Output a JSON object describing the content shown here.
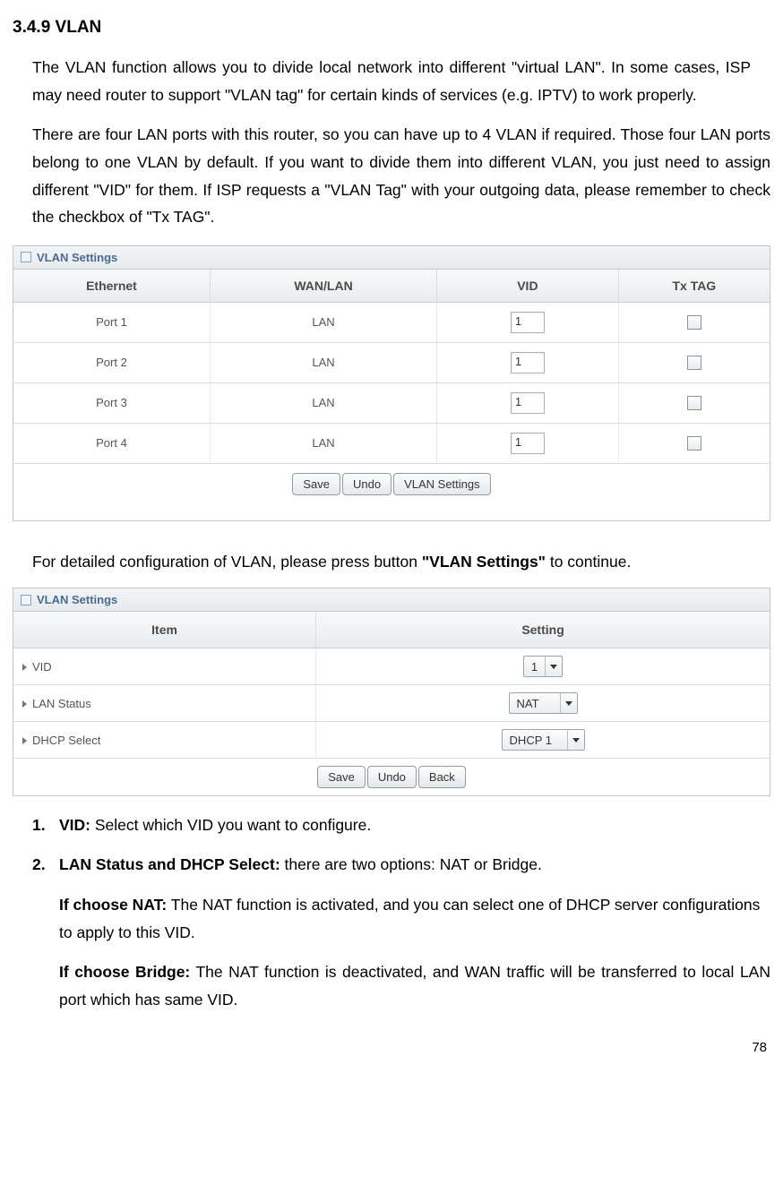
{
  "heading": "3.4.9 VLAN",
  "intro_p1": "The VLAN function allows you to divide local network into different \"virtual LAN\". In some cases, ISP may need router to support \"VLAN tag\" for certain kinds of services (e.g. IPTV) to work properly.",
  "intro_p2": "There are four LAN ports with this router, so you can have up to 4 VLAN if required. Those four LAN ports belong to one VLAN by default. If you want to divide them into different VLAN, you just need to assign different \"VID\" for them. If ISP requests a \"VLAN Tag\" with your outgoing data, please remember to check the checkbox of \"Tx TAG\".",
  "panel1": {
    "title": "VLAN Settings",
    "headers": [
      "Ethernet",
      "WAN/LAN",
      "VID",
      "Tx TAG"
    ],
    "rows": [
      {
        "eth": "Port 1",
        "wl": "LAN",
        "vid": "1"
      },
      {
        "eth": "Port 2",
        "wl": "LAN",
        "vid": "1"
      },
      {
        "eth": "Port 3",
        "wl": "LAN",
        "vid": "1"
      },
      {
        "eth": "Port 4",
        "wl": "LAN",
        "vid": "1"
      }
    ],
    "buttons": {
      "save": "Save",
      "undo": "Undo",
      "vsettings": "VLAN Settings"
    }
  },
  "mid_text_pre": "For detailed configuration of VLAN, please press button ",
  "mid_text_bold": "\"VLAN Settings\"",
  "mid_text_post": " to continue.",
  "panel2": {
    "title": "VLAN Settings",
    "headers": {
      "item": "Item",
      "setting": "Setting"
    },
    "rows": [
      {
        "label": "VID",
        "value": "1"
      },
      {
        "label": "LAN Status",
        "value": "NAT"
      },
      {
        "label": "DHCP Select",
        "value": "DHCP 1"
      }
    ],
    "buttons": {
      "save": "Save",
      "undo": "Undo",
      "back": "Back"
    }
  },
  "list": {
    "n1_label": "1.",
    "n1_bold": "VID:",
    "n1_text": " Select which VID you want to configure.",
    "n2_label": "2.",
    "n2_bold": "LAN Status and DHCP Select:",
    "n2_text": " there are two options: NAT or Bridge.",
    "nat_bold": "If choose NAT:",
    "nat_text": " The NAT function is activated, and you can select one of DHCP server configurations to apply to this VID.",
    "bridge_bold": "If choose Bridge:",
    "bridge_text": " The NAT function is deactivated, and WAN traffic will be transferred to local LAN port which has same VID."
  },
  "page_number": "78"
}
